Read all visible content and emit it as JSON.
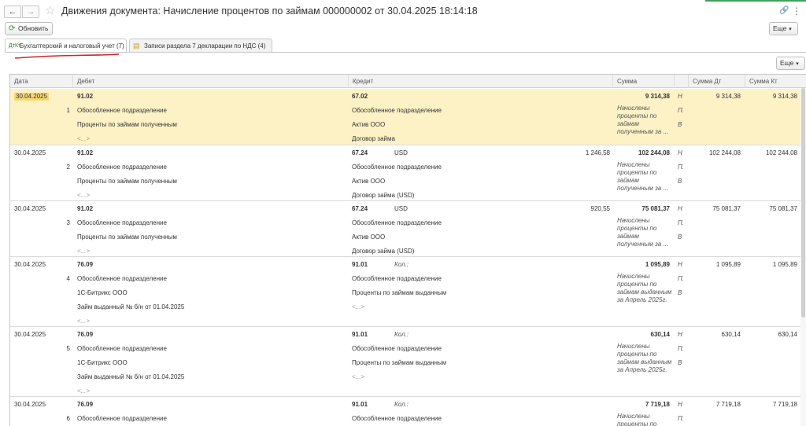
{
  "window": {
    "title": "Движения документа: Начисление процентов по займам 000000002 от 30.04.2025 18:14:18",
    "back_icon": "←",
    "forward_icon": "→",
    "star_icon": "☆",
    "link_icon": "🔗",
    "more_icon": "⋮",
    "close_icon": "✕"
  },
  "toolbar": {
    "refresh_label": "Обновить",
    "more_label": "Еще"
  },
  "tabs": [
    {
      "label": "Бухгалтерский и налоговый учет (7)",
      "icon": "ДтКт"
    },
    {
      "label": "Записи раздела 7 декларации по НДС (4)",
      "icon": "▤"
    }
  ],
  "table_more_label": "Еще",
  "columns": {
    "date": "Дата",
    "debit": "Дебет",
    "credit": "Кредит",
    "sum": "Сумма",
    "sum_dt": "Сумма Дт",
    "sum_kt": "Сумма Кт"
  },
  "rows": [
    {
      "date": "30.04.2025",
      "num": "1",
      "dt_account": "91.02",
      "dt_sub1": "Обособленное подразделение",
      "dt_sub2": "Проценты по займам полученным",
      "dt_sub3": "<...>",
      "kt_account": "67.02",
      "kt_extra": "",
      "kt_amount": "",
      "kt_sub1": "Обособленное подразделение",
      "kt_sub2": "Актив ООО",
      "kt_sub3": "Договор займа",
      "sum": "9 314,38",
      "content": "Начислены проценты по займам полученным за ...",
      "flag_n": "Н",
      "flag_p": "П.",
      "flag_v": "В",
      "sum_dt": "9 314,38",
      "sum_kt": "9 314,38"
    },
    {
      "date": "30.04.2025",
      "num": "2",
      "dt_account": "91.02",
      "dt_sub1": "Обособленное подразделение",
      "dt_sub2": "Проценты по займам полученным",
      "dt_sub3": "<...>",
      "kt_account": "67.24",
      "kt_extra": "USD",
      "kt_amount": "1 246,58",
      "kt_sub1": "Обособленное подразделение",
      "kt_sub2": "Актив ООО",
      "kt_sub3": "Договор займа (USD)",
      "sum": "102 244,08",
      "content": "Начислены проценты по займам полученным за ...",
      "flag_n": "Н",
      "flag_p": "П.",
      "flag_v": "В",
      "sum_dt": "102 244,08",
      "sum_kt": "102 244,08"
    },
    {
      "date": "30.04.2025",
      "num": "3",
      "dt_account": "91.02",
      "dt_sub1": "Обособленное подразделение",
      "dt_sub2": "Проценты по займам полученным",
      "dt_sub3": "<...>",
      "kt_account": "67.24",
      "kt_extra": "USD",
      "kt_amount": "920,55",
      "kt_sub1": "Обособленное подразделение",
      "kt_sub2": "Актив ООО",
      "kt_sub3": "Договор займа (USD)",
      "sum": "75 081,37",
      "content": "Начислены проценты по займам полученным за ...",
      "flag_n": "Н",
      "flag_p": "П.",
      "flag_v": "В",
      "sum_dt": "75 081,37",
      "sum_kt": "75 081,37"
    },
    {
      "date": "30.04.2025",
      "num": "4",
      "dt_account": "76.09",
      "dt_sub1": "Обособленное подразделение",
      "dt_sub2": "1С-Битрикс ООО",
      "dt_sub3": "Займ выданный № б/н от 01.04.2025",
      "dt_sub4": "<...>",
      "kt_account": "91.01",
      "kt_extra": "Кол.:",
      "kt_amount": "",
      "kt_sub1": "Обособленное подразделение",
      "kt_sub2": "Проценты по займам выданным",
      "kt_sub3": "<...>",
      "sum": "1 095,89",
      "content": "Начислены проценты по займам выданным за Апрель 2025г.",
      "flag_n": "Н",
      "flag_p": "П.",
      "flag_v": "В",
      "sum_dt": "1 095,89",
      "sum_kt": "1 095,89"
    },
    {
      "date": "30.04.2025",
      "num": "5",
      "dt_account": "76.09",
      "dt_sub1": "Обособленное подразделение",
      "dt_sub2": "1С-Битрикс ООО",
      "dt_sub3": "Займ выданный № б/н от 01.04.2025",
      "dt_sub4": "<...>",
      "kt_account": "91.01",
      "kt_extra": "Кол.:",
      "kt_amount": "",
      "kt_sub1": "Обособленное подразделение",
      "kt_sub2": "Проценты по займам выданным",
      "kt_sub3": "<...>",
      "sum": "630,14",
      "content": "Начислены проценты по займам выданным за Апрель 2025г.",
      "flag_n": "Н",
      "flag_p": "П.",
      "flag_v": "В",
      "sum_dt": "630,14",
      "sum_kt": "630,14"
    },
    {
      "date": "30.04.2025",
      "num": "6",
      "dt_account": "76.09",
      "dt_sub1": "Обособленное подразделение",
      "dt_sub2": "",
      "dt_sub3": "",
      "kt_account": "91.01",
      "kt_extra": "Кол.:",
      "kt_amount": "",
      "kt_sub1": "Обособленное подразделение",
      "kt_sub2": "",
      "kt_sub3": "",
      "sum": "7 719,18",
      "content": "Начислены проценты по",
      "flag_n": "Н",
      "flag_p": "П.",
      "flag_v": "",
      "sum_dt": "7 719,18",
      "sum_kt": "7 719,18"
    }
  ]
}
